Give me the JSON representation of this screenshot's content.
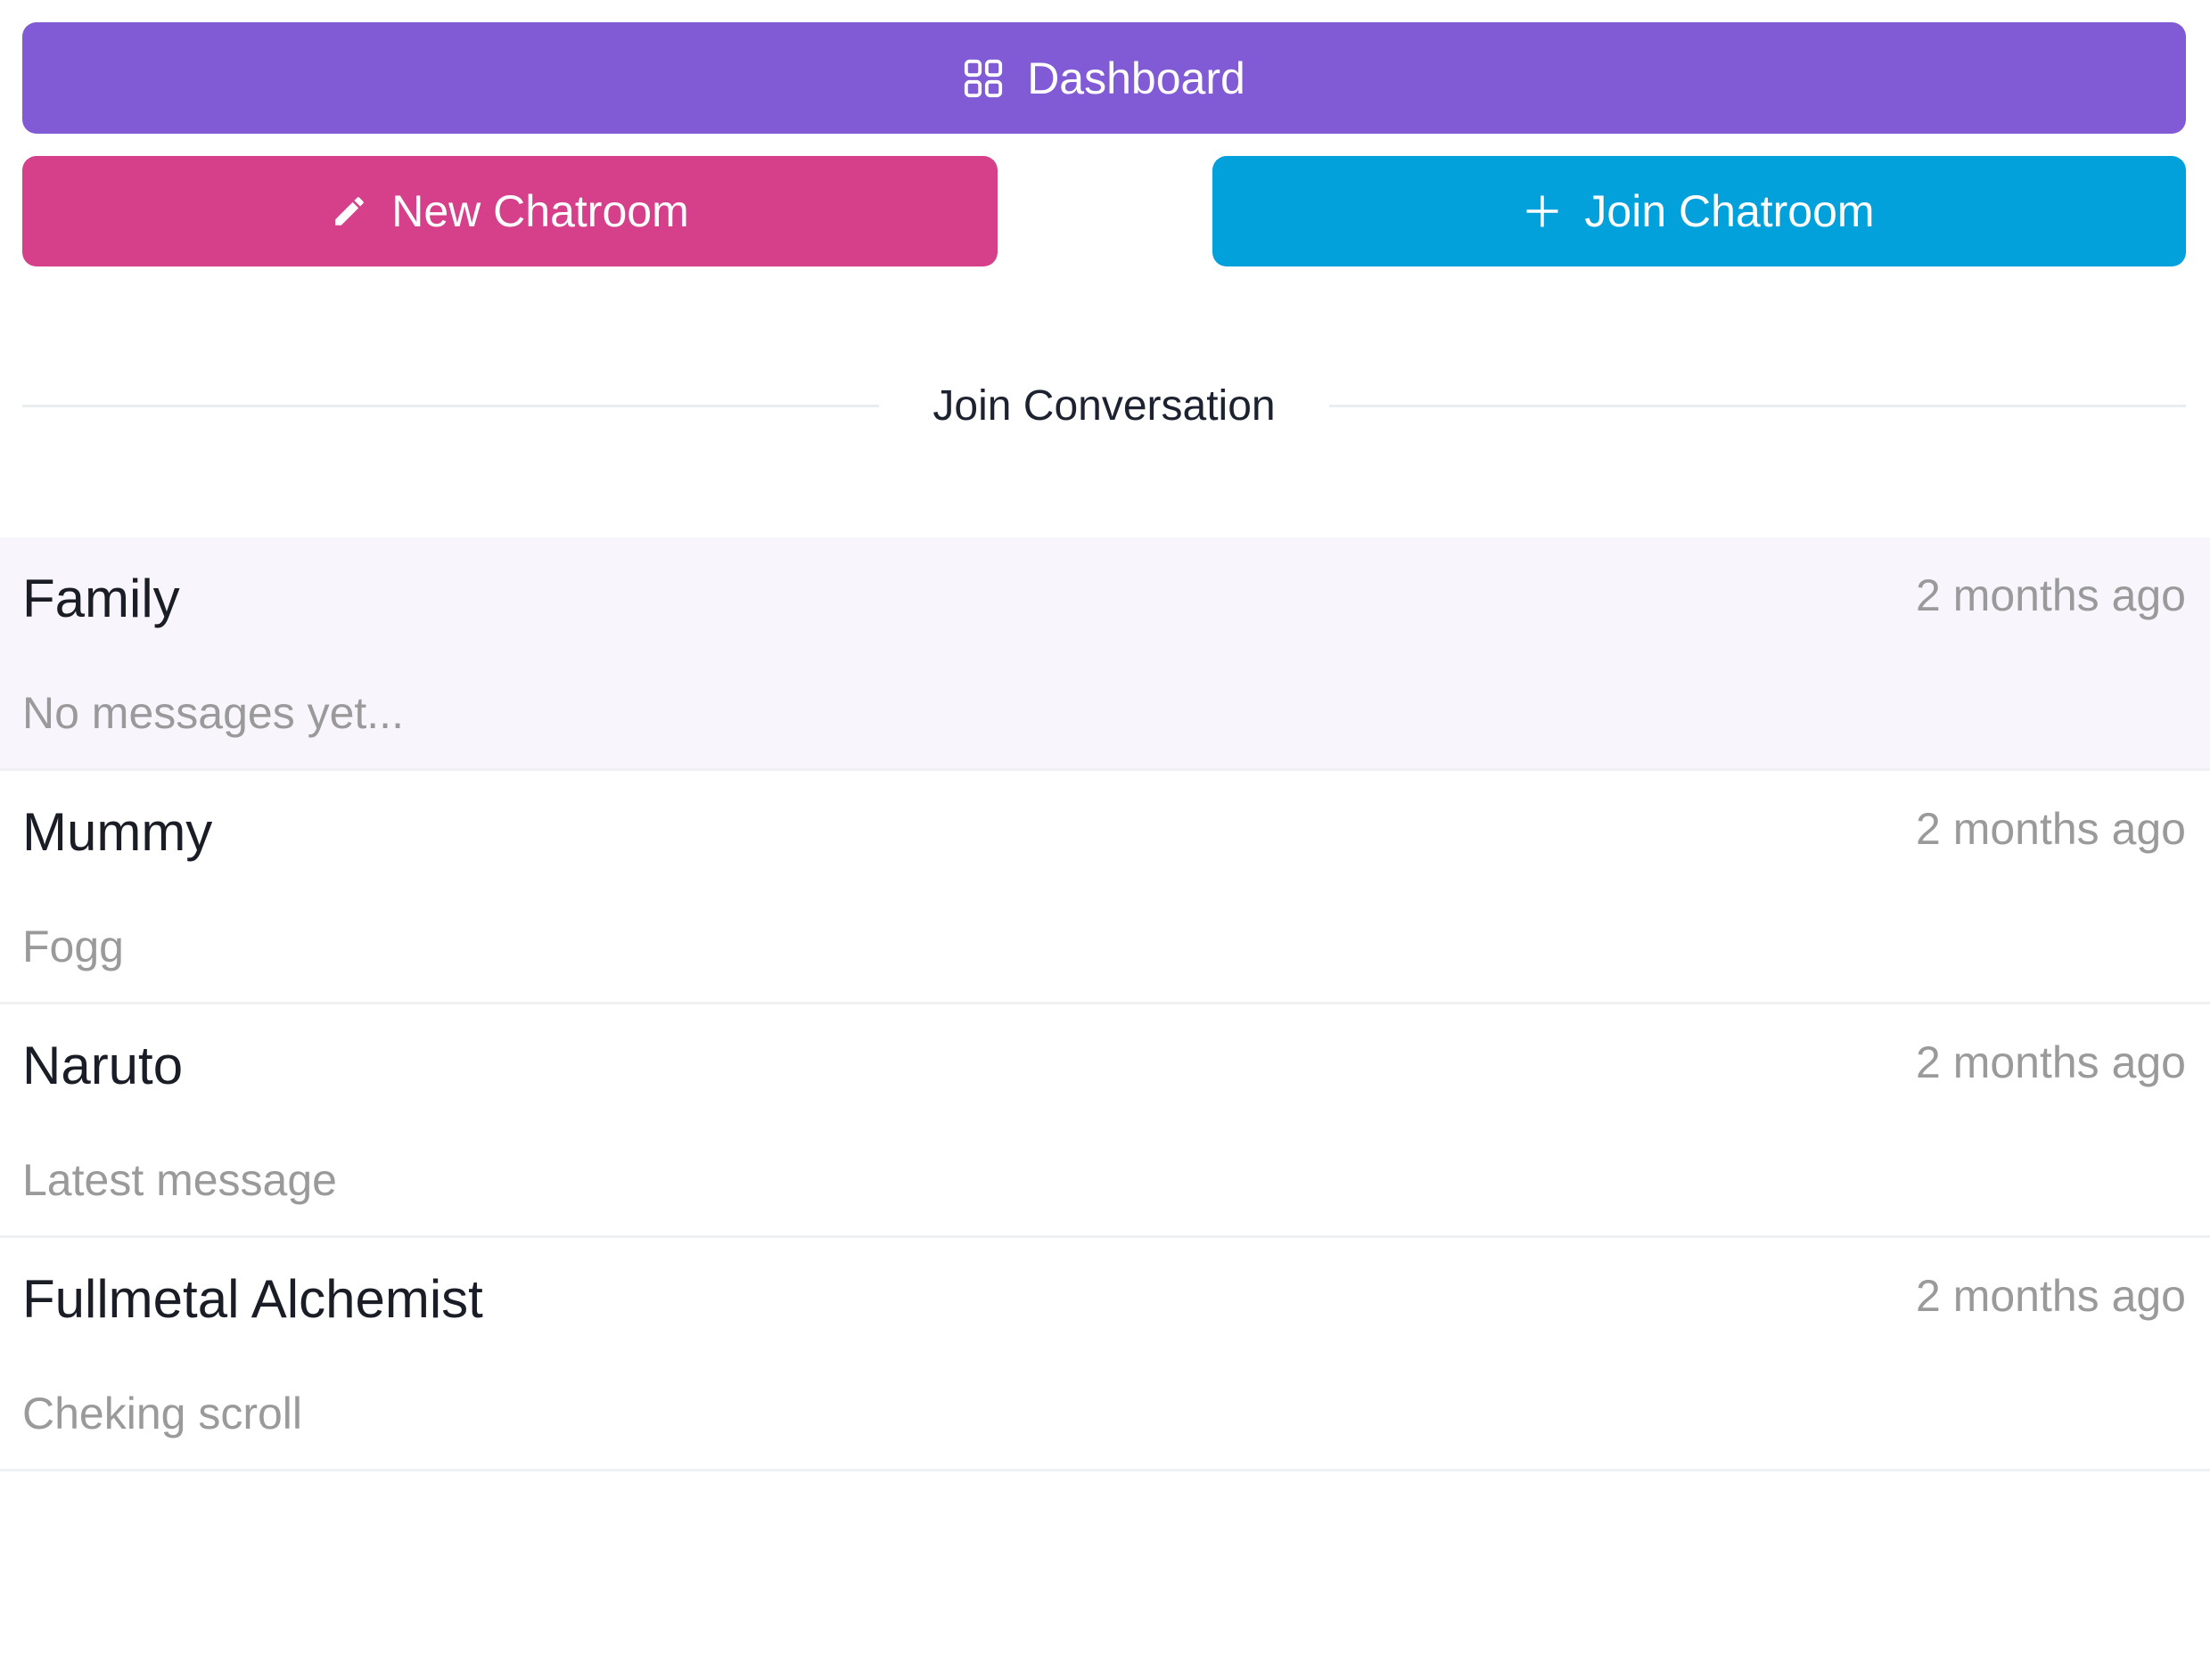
{
  "buttons": {
    "dashboard": "Dashboard",
    "new_chatroom": "New Chatroom",
    "join_chatroom": "Join Chatroom"
  },
  "divider_label": "Join Conversation",
  "colors": {
    "dashboard": "#815bd5",
    "new_chatroom": "#d6408b",
    "join_chatroom": "#02a1dc",
    "active_row": "#f9f5fd"
  },
  "chatrooms": [
    {
      "name": "Family",
      "time": "2 months ago",
      "last_message": "No messages yet..."
    },
    {
      "name": "Mummy",
      "time": "2 months ago",
      "last_message": "Fogg"
    },
    {
      "name": "Naruto",
      "time": "2 months ago",
      "last_message": "Latest message"
    },
    {
      "name": "Fullmetal Alchemist",
      "time": "2 months ago",
      "last_message": "Cheking scroll"
    }
  ]
}
